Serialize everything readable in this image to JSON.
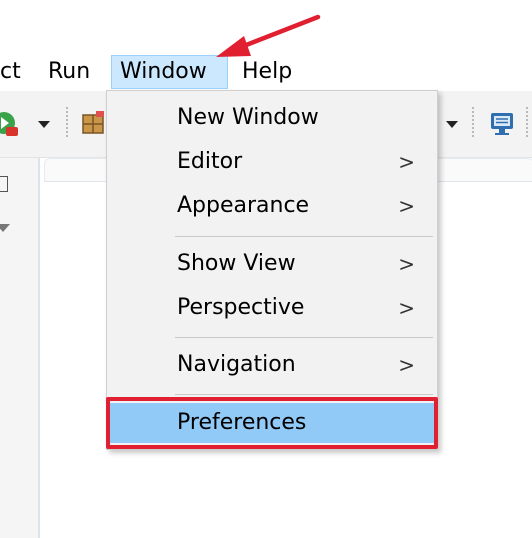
{
  "menubar": {
    "items": [
      {
        "label": "ct"
      },
      {
        "label": "Run"
      },
      {
        "label": "Window"
      },
      {
        "label": "Help"
      }
    ]
  },
  "toolbar": {
    "icons": [
      "run-icon",
      "dropdown-arrow-icon",
      "package-icon",
      "dropdown-arrow-icon",
      "monitor-icon"
    ]
  },
  "window_menu": {
    "items": [
      {
        "label": "New Window",
        "submenu": false
      },
      {
        "label": "Editor",
        "submenu": true
      },
      {
        "label": "Appearance",
        "submenu": true
      },
      {
        "label": "Show View",
        "submenu": true
      },
      {
        "label": "Perspective",
        "submenu": true
      },
      {
        "label": "Navigation",
        "submenu": true
      },
      {
        "label": "Preferences",
        "submenu": false,
        "selected": true
      }
    ],
    "submenu_glyph": ">"
  },
  "annotation": {
    "highlight_color": "#e02030",
    "arrow_color": "#e02030"
  },
  "colors": {
    "menubar_active": "#cce8ff",
    "menu_selected": "#91c9f7",
    "menu_background": "#f2f2f2"
  }
}
